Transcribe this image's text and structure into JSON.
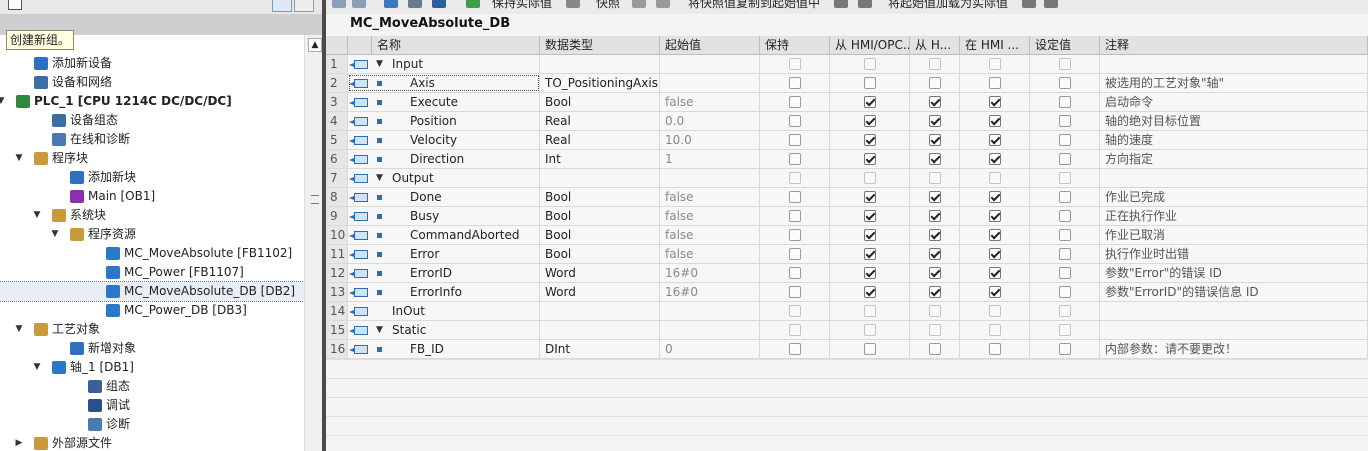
{
  "tooltip": "创建新组。",
  "tree": [
    {
      "label": "添加新设备",
      "icon": "add-device-icon",
      "level": 2
    },
    {
      "label": "设备和网络",
      "icon": "network-icon",
      "level": 2
    },
    {
      "label": "PLC_1 [CPU 1214C DC/DC/DC]",
      "icon": "plc-icon",
      "level": 1,
      "expanded": true,
      "bold": true
    },
    {
      "label": "设备组态",
      "icon": "device-config-icon",
      "level": 3
    },
    {
      "label": "在线和诊断",
      "icon": "diagnostics-icon",
      "level": 3
    },
    {
      "label": "程序块",
      "icon": "folder-icon",
      "level": 2,
      "expanded": true
    },
    {
      "label": "添加新块",
      "icon": "add-block-icon",
      "level": 4
    },
    {
      "label": "Main [OB1]",
      "icon": "ob-icon",
      "level": 4
    },
    {
      "label": "系统块",
      "icon": "folder-icon",
      "level": 3,
      "expanded": true
    },
    {
      "label": "程序资源",
      "icon": "folder-icon",
      "level": 4,
      "expanded": true
    },
    {
      "label": "MC_MoveAbsolute [FB1102]",
      "icon": "fb-icon",
      "level": 6
    },
    {
      "label": "MC_Power [FB1107]",
      "icon": "fb-icon",
      "level": 6
    },
    {
      "label": "MC_MoveAbsolute_DB [DB2]",
      "icon": "db-icon",
      "level": 6,
      "selected": true
    },
    {
      "label": "MC_Power_DB [DB3]",
      "icon": "db-icon",
      "level": 6
    },
    {
      "label": "工艺对象",
      "icon": "folder-icon",
      "level": 2,
      "expanded": true
    },
    {
      "label": "新增对象",
      "icon": "add-object-icon",
      "level": 4
    },
    {
      "label": "轴_1 [DB1]",
      "icon": "axis-icon",
      "level": 3,
      "expanded": true
    },
    {
      "label": "组态",
      "icon": "config-icon",
      "level": 5
    },
    {
      "label": "调试",
      "icon": "commissioning-icon",
      "level": 5
    },
    {
      "label": "诊断",
      "icon": "diagnostics-icon",
      "level": 5
    },
    {
      "label": "外部源文件",
      "icon": "folder-icon",
      "level": 2,
      "collapsed": true
    }
  ],
  "toolbar": {
    "btn1": "保持实际值",
    "btn2": "快照",
    "btn3": "将快照值复制到起始值中",
    "btn4": "将起始值加载为实际值"
  },
  "db_title": "MC_MoveAbsolute_DB",
  "columns": [
    "名称",
    "数据类型",
    "起始值",
    "保持",
    "从 HMI/OPC...",
    "从 H...",
    "在 HMI ...",
    "设定值",
    "注释"
  ],
  "rows": [
    {
      "num": "1",
      "name": "Input",
      "type": "",
      "start": "",
      "retain": null,
      "hmi1": null,
      "hmi2": null,
      "hmi3": null,
      "setpoint": null,
      "comment": "",
      "group": true
    },
    {
      "num": "2",
      "name": "Axis",
      "type": "TO_PositioningAxis",
      "start": "",
      "retain": false,
      "hmi1": false,
      "hmi2": false,
      "hmi3": false,
      "setpoint": false,
      "comment": "被选用的工艺对象\"轴\""
    },
    {
      "num": "3",
      "name": "Execute",
      "type": "Bool",
      "start": "false",
      "retain": false,
      "hmi1": true,
      "hmi2": true,
      "hmi3": true,
      "setpoint": false,
      "comment": "启动命令"
    },
    {
      "num": "4",
      "name": "Position",
      "type": "Real",
      "start": "0.0",
      "retain": false,
      "hmi1": true,
      "hmi2": true,
      "hmi3": true,
      "setpoint": false,
      "comment": "轴的绝对目标位置"
    },
    {
      "num": "5",
      "name": "Velocity",
      "type": "Real",
      "start": "10.0",
      "retain": false,
      "hmi1": true,
      "hmi2": true,
      "hmi3": true,
      "setpoint": false,
      "comment": "轴的速度"
    },
    {
      "num": "6",
      "name": "Direction",
      "type": "Int",
      "start": "1",
      "retain": false,
      "hmi1": true,
      "hmi2": true,
      "hmi3": true,
      "setpoint": false,
      "comment": "方向指定"
    },
    {
      "num": "7",
      "name": "Output",
      "type": "",
      "start": "",
      "retain": null,
      "hmi1": null,
      "hmi2": null,
      "hmi3": null,
      "setpoint": null,
      "comment": "",
      "group": true
    },
    {
      "num": "8",
      "name": "Done",
      "type": "Bool",
      "start": "false",
      "retain": false,
      "hmi1": true,
      "hmi2": true,
      "hmi3": true,
      "setpoint": false,
      "comment": "作业已完成"
    },
    {
      "num": "9",
      "name": "Busy",
      "type": "Bool",
      "start": "false",
      "retain": false,
      "hmi1": true,
      "hmi2": true,
      "hmi3": true,
      "setpoint": false,
      "comment": "正在执行作业"
    },
    {
      "num": "10",
      "name": "CommandAborted",
      "type": "Bool",
      "start": "false",
      "retain": false,
      "hmi1": true,
      "hmi2": true,
      "hmi3": true,
      "setpoint": false,
      "comment": "作业已取消"
    },
    {
      "num": "11",
      "name": "Error",
      "type": "Bool",
      "start": "false",
      "retain": false,
      "hmi1": true,
      "hmi2": true,
      "hmi3": true,
      "setpoint": false,
      "comment": "执行作业时出错"
    },
    {
      "num": "12",
      "name": "ErrorID",
      "type": "Word",
      "start": "16#0",
      "retain": false,
      "hmi1": true,
      "hmi2": true,
      "hmi3": true,
      "setpoint": false,
      "comment": "参数\"Error\"的错误 ID"
    },
    {
      "num": "13",
      "name": "ErrorInfo",
      "type": "Word",
      "start": "16#0",
      "retain": false,
      "hmi1": true,
      "hmi2": true,
      "hmi3": true,
      "setpoint": false,
      "comment": "参数\"ErrorID\"的错误信息 ID"
    },
    {
      "num": "14",
      "name": "InOut",
      "type": "",
      "start": "",
      "retain": null,
      "hmi1": null,
      "hmi2": null,
      "hmi3": null,
      "setpoint": null,
      "comment": "",
      "group": true,
      "noexp": true
    },
    {
      "num": "15",
      "name": "Static",
      "type": "",
      "start": "",
      "retain": null,
      "hmi1": null,
      "hmi2": null,
      "hmi3": null,
      "setpoint": null,
      "comment": "",
      "group": true
    },
    {
      "num": "16",
      "name": "FB_ID",
      "type": "DInt",
      "start": "0",
      "retain": false,
      "hmi1": false,
      "hmi2": false,
      "hmi3": false,
      "setpoint": false,
      "comment": "内部参数：请不要更改！"
    }
  ]
}
